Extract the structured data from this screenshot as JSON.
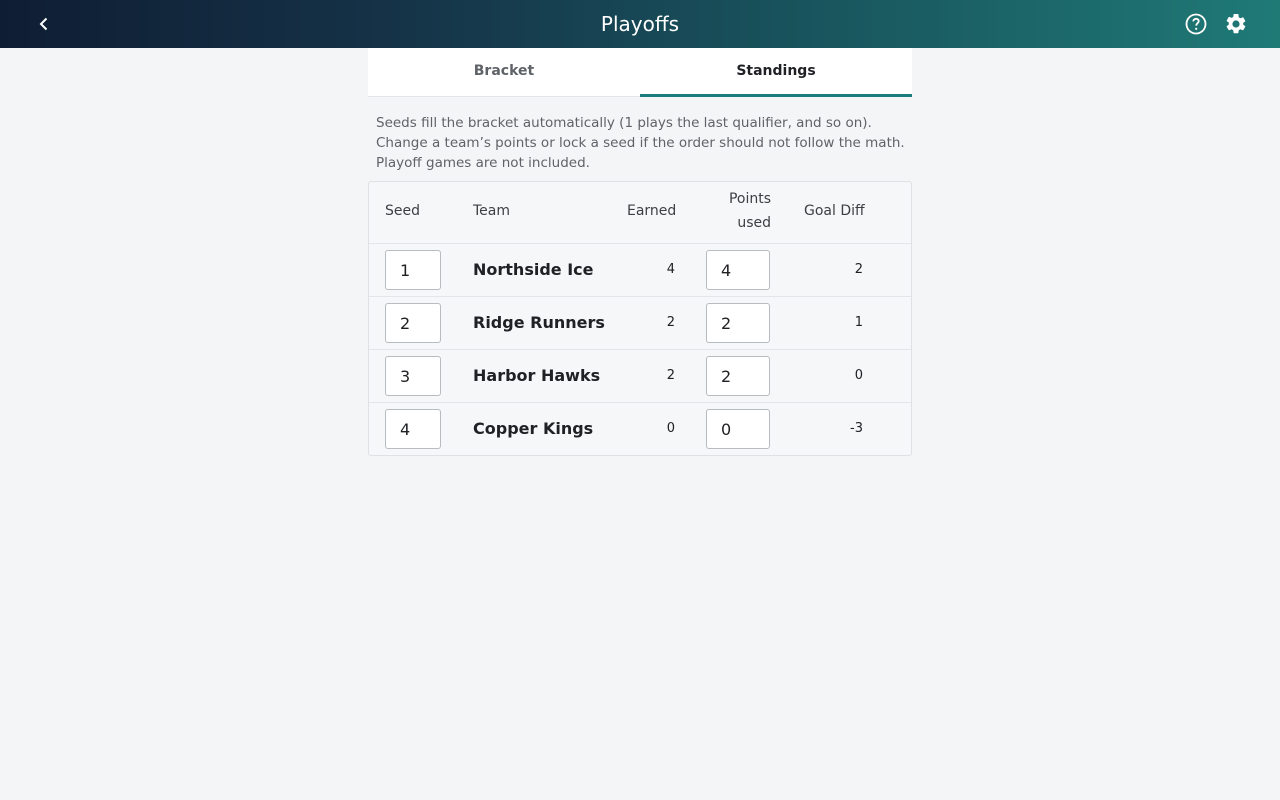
{
  "appbar": {
    "title": "Playoffs"
  },
  "tabs": [
    {
      "label": "Bracket",
      "active": false
    },
    {
      "label": "Standings",
      "active": true
    }
  ],
  "help": {
    "line1": "Seeds fill the bracket automatically (1 plays the last qualifier, and so on).",
    "line2": "Change a team’s points or lock a seed if the order should not follow the math.",
    "line3": "Playoff games are not included."
  },
  "table": {
    "headers": {
      "seed": "Seed",
      "team": "Team",
      "earned": "Earned",
      "points_used_line1": "Points",
      "points_used_line2": "used",
      "goal_diff": "Goal Diff"
    },
    "rows": [
      {
        "seed": "1",
        "team": "Northside Ice",
        "earned": "4",
        "points_used": "4",
        "goal_diff": "2"
      },
      {
        "seed": "2",
        "team": "Ridge Runners",
        "earned": "2",
        "points_used": "2",
        "goal_diff": "1"
      },
      {
        "seed": "3",
        "team": "Harbor Hawks",
        "earned": "2",
        "points_used": "2",
        "goal_diff": "0"
      },
      {
        "seed": "4",
        "team": "Copper Kings",
        "earned": "0",
        "points_used": "0",
        "goal_diff": "-3"
      }
    ]
  },
  "icons": {
    "back": "chevron-left-icon",
    "help": "help-circle-icon",
    "settings": "gear-icon"
  },
  "colors": {
    "accent": "#1c7d80",
    "appbar_start": "#0f1d33",
    "appbar_end": "#1f7a76"
  }
}
